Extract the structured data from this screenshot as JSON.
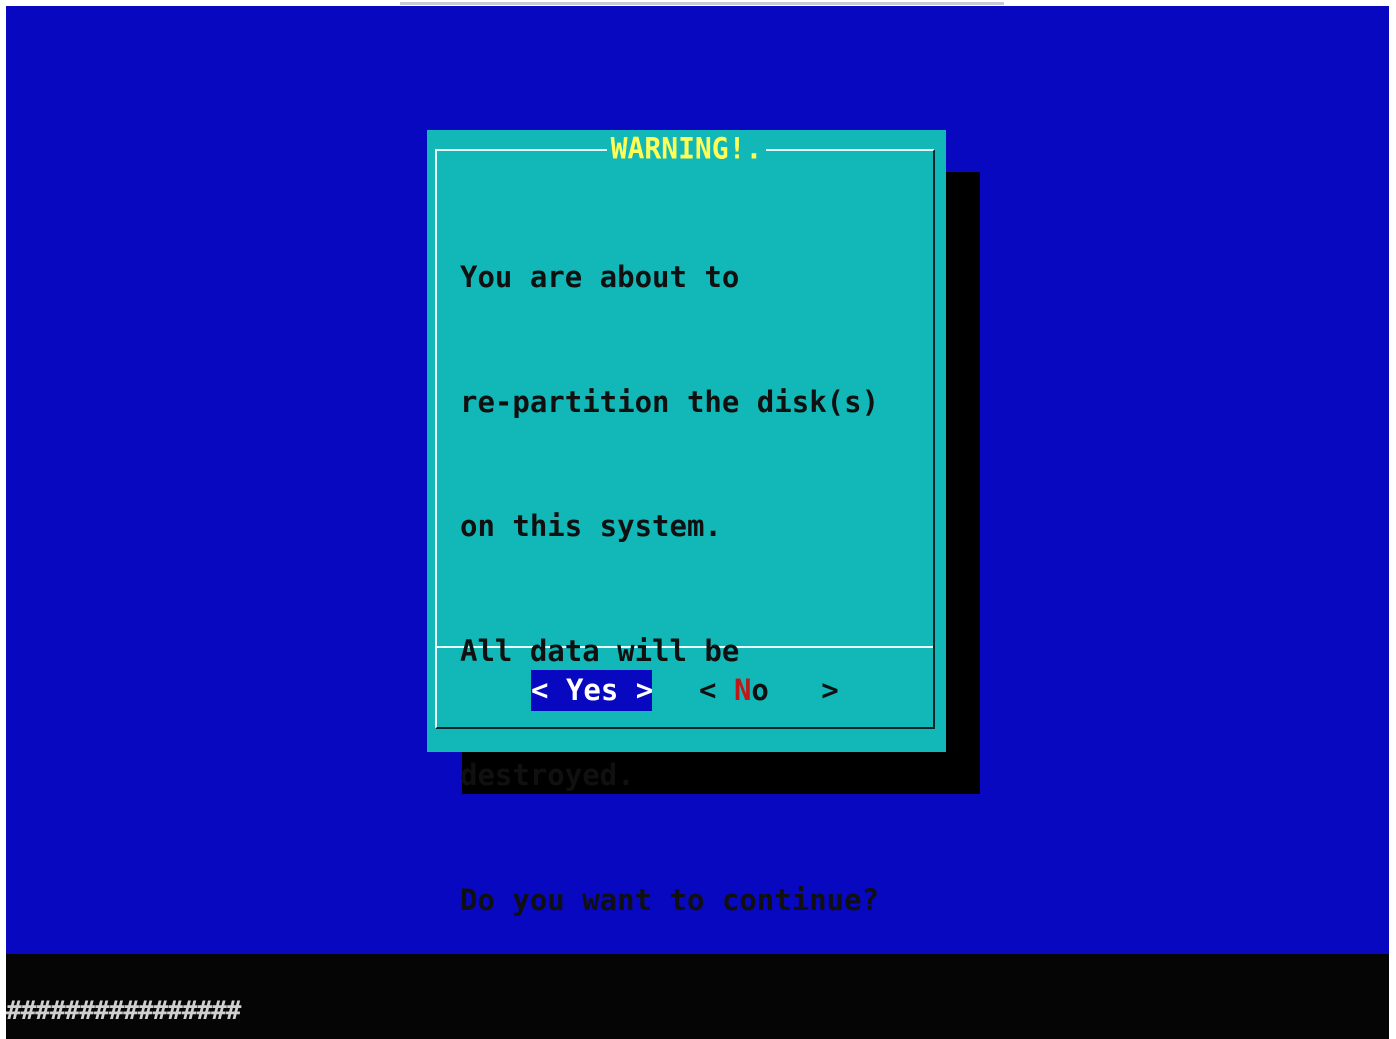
{
  "dialog": {
    "title": "WARNING!.",
    "message_lines": [
      "You are about to",
      "re-partition the disk(s)",
      "on this system.",
      "All data will be",
      "destroyed.",
      "Do you want to continue?"
    ],
    "buttons": {
      "yes": {
        "left_bracket": "<",
        "label": "Yes",
        "right_bracket": ">"
      },
      "no": {
        "left_bracket": "<",
        "hotkey": "N",
        "label_rest": "o",
        "right_bracket": ">"
      }
    }
  },
  "status_bar": {
    "progress_text": "################"
  },
  "colors": {
    "screen_background": "#0808c0",
    "dialog_background": "#12b8b8",
    "title_color": "#ffff55",
    "selected_button_background": "#0808c0",
    "hotkey_color": "#c01818",
    "shadow": "#000000"
  }
}
